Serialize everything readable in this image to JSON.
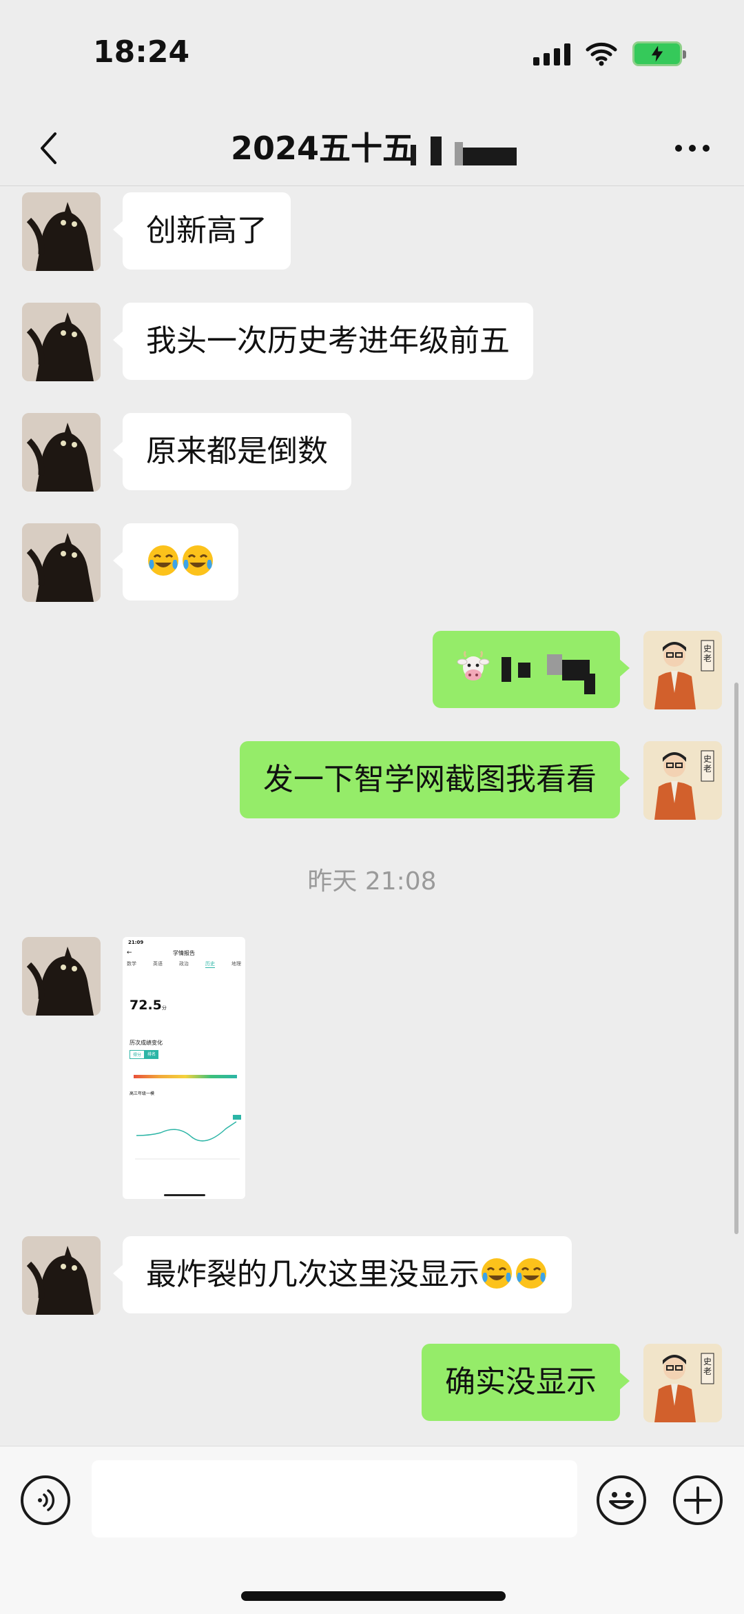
{
  "status_bar": {
    "time": "18:24"
  },
  "header": {
    "title": "2024五十五"
  },
  "messages": [
    {
      "side": "in",
      "text": "创新高了"
    },
    {
      "side": "in",
      "text": "我头一次历史考进年级前五"
    },
    {
      "side": "in",
      "text": "原来都是倒数"
    },
    {
      "side": "in",
      "emojis": [
        "crying-laughing-emoji",
        "crying-laughing-emoji"
      ]
    },
    {
      "side": "out",
      "emoji": "cow-face-emoji"
    },
    {
      "side": "out",
      "text": "发一下智学网截图我看看"
    },
    {
      "side": "in",
      "type": "image"
    },
    {
      "side": "in",
      "text": "最炸裂的几次这里没显示",
      "emojis": [
        "crying-laughing-emoji",
        "crying-laughing-emoji"
      ]
    },
    {
      "side": "out",
      "text": "确实没显示"
    }
  ],
  "timestamp": "昨天 21:08",
  "thumbnail": {
    "time": "21:09",
    "title": "学情报告",
    "tabs": [
      "数学",
      "英语",
      "政治",
      "历史",
      "地理"
    ],
    "active_tab": "历史",
    "score": "72.5",
    "score_unit": "分",
    "section_title": "历次成绩变化",
    "toggle_options": [
      "得分",
      "排名"
    ],
    "grade_label": "高三年级一模"
  },
  "colors": {
    "outgoing_bubble": "#95ec69",
    "incoming_bubble": "#ffffff",
    "background": "#ededed",
    "accent_teal": "#2cb5a6"
  }
}
